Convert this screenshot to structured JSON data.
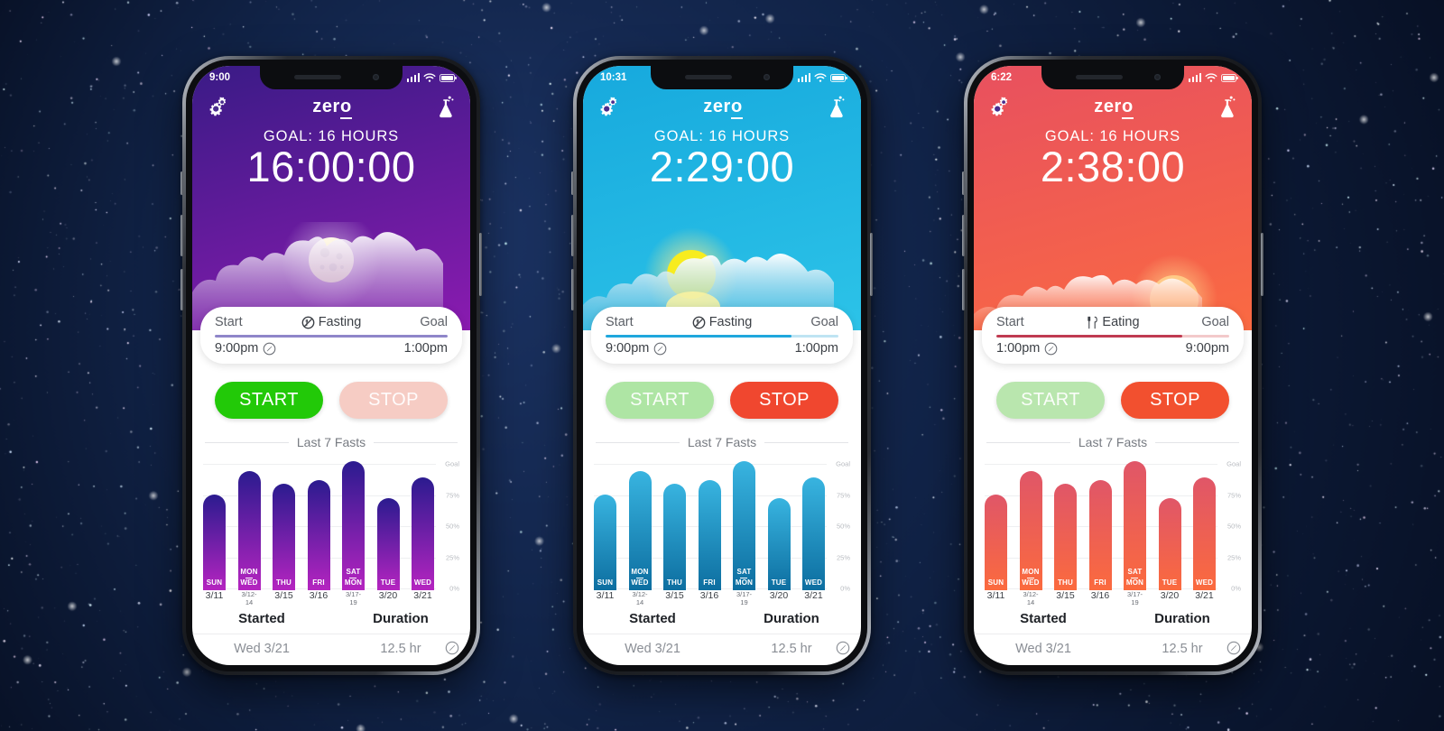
{
  "background": {
    "name": "starfield",
    "color": "#0b172e"
  },
  "phones": [
    {
      "id": "phone-night",
      "theme": {
        "sky_top": "#3a1b86",
        "sky_bottom": "#8a1bb0",
        "accent": "#7f5fd6",
        "bar_top": "#2b1b8f",
        "bar_bottom": "#b524c0",
        "progress_fill": "#8f86c9",
        "progress_track": "#cfcbe6",
        "scene": "moon"
      },
      "status_bar": {
        "time": "9:00",
        "signal_icon": "signal-bars-icon",
        "wifi_icon": "wifi-icon",
        "battery_icon": "battery-icon"
      },
      "app_bar": {
        "settings_icon": "gears-icon",
        "brand": "zer",
        "brand_tail": "o",
        "lab_icon": "flask-icon"
      },
      "goal_label": "GOAL: 16 HOURS",
      "timer": "16:00:00",
      "card": {
        "start_label": "Start",
        "state_icon": "no-food-icon",
        "state_label": "Fasting",
        "goal_label": "Goal",
        "start_time": "9:00pm",
        "edit_icon": "edit-pencil-icon",
        "goal_time": "1:00pm",
        "progress_percent": 100
      },
      "actions": {
        "start_label": "START",
        "start_enabled": true,
        "start_color": "#22c908",
        "start_disabled_color": "#b6e8ab",
        "stop_label": "STOP",
        "stop_enabled": false,
        "stop_color": "#f04b33",
        "stop_disabled_color": "#f6ccc4"
      },
      "chart_title": "Last 7 Fasts",
      "table": {
        "headers": [
          "Started",
          "Duration"
        ],
        "row": [
          "Wed 3/21",
          "12.5 hr"
        ],
        "edit_icon": "edit-pencil-icon"
      }
    },
    {
      "id": "phone-day",
      "theme": {
        "sky_top": "#17a9dd",
        "sky_bottom": "#2cc3e8",
        "accent": "#1b9fd8",
        "bar_top": "#38b4e0",
        "bar_bottom": "#0d6ea0",
        "progress_fill": "#1fa7dd",
        "progress_track": "#bfe4f3",
        "scene": "sun"
      },
      "status_bar": {
        "time": "10:31",
        "signal_icon": "signal-bars-icon",
        "wifi_icon": "wifi-icon",
        "battery_icon": "battery-icon"
      },
      "app_bar": {
        "settings_icon": "gears-icon",
        "brand": "zer",
        "brand_tail": "o",
        "lab_icon": "flask-icon"
      },
      "goal_label": "GOAL: 16 HOURS",
      "timer": "2:29:00",
      "card": {
        "start_label": "Start",
        "state_icon": "no-food-icon",
        "state_label": "Fasting",
        "goal_label": "Goal",
        "start_time": "9:00pm",
        "edit_icon": "edit-pencil-icon",
        "goal_time": "1:00pm",
        "progress_percent": 80
      },
      "actions": {
        "start_label": "START",
        "start_enabled": false,
        "start_color": "#22c908",
        "start_disabled_color": "#aee5a4",
        "stop_label": "STOP",
        "stop_enabled": true,
        "stop_color": "#f0472f",
        "stop_disabled_color": "#f6ccc4"
      },
      "chart_title": "Last 7 Fasts",
      "table": {
        "headers": [
          "Started",
          "Duration"
        ],
        "row": [
          "Wed 3/21",
          "12.5 hr"
        ],
        "edit_icon": "edit-pencil-icon"
      }
    },
    {
      "id": "phone-sunset",
      "theme": {
        "sky_top": "#e8505f",
        "sky_bottom": "#fa6a42",
        "accent": "#e8505f",
        "bar_top": "#e05668",
        "bar_bottom": "#fb6a3e",
        "progress_fill": "#c03b51",
        "progress_track": "#f3c9ca",
        "scene": "sunset"
      },
      "status_bar": {
        "time": "6:22",
        "signal_icon": "signal-bars-icon",
        "wifi_icon": "wifi-icon",
        "battery_icon": "battery-icon"
      },
      "app_bar": {
        "settings_icon": "gears-icon",
        "brand": "zer",
        "brand_tail": "o",
        "lab_icon": "flask-icon"
      },
      "goal_label": "GOAL: 16 HOURS",
      "timer": "2:38:00",
      "card": {
        "start_label": "Start",
        "state_icon": "utensils-icon",
        "state_label": "Eating",
        "goal_label": "Goal",
        "start_time": "1:00pm",
        "edit_icon": "edit-pencil-icon",
        "goal_time": "9:00pm",
        "progress_percent": 80
      },
      "actions": {
        "start_label": "START",
        "start_enabled": false,
        "start_color": "#22c908",
        "start_disabled_color": "#b9e6ae",
        "stop_label": "STOP",
        "stop_enabled": true,
        "stop_color": "#f2502f",
        "stop_disabled_color": "#f6ccc4"
      },
      "chart_title": "Last 7 Fasts",
      "table": {
        "headers": [
          "Started",
          "Duration"
        ],
        "row": [
          "Wed 3/21",
          "12.5 hr"
        ],
        "edit_icon": "edit-pencil-icon"
      }
    }
  ],
  "chart_data": {
    "type": "bar",
    "title": "Last 7 Fasts",
    "xlabel": "",
    "ylabel": "",
    "ylim": [
      0,
      110
    ],
    "grid": true,
    "legend": false,
    "y_ticks": [
      0,
      25,
      50,
      75,
      100
    ],
    "y_tick_labels": [
      "0%",
      "25%",
      "50%",
      "75%",
      "Goal"
    ],
    "categories": [
      "SUN",
      "MON\nWED",
      "THU",
      "FRI",
      "SAT\nMON",
      "TUE",
      "WED"
    ],
    "day_labels": [
      {
        "line1": "SUN",
        "line2": ""
      },
      {
        "line1": "MON",
        "line2": "WED"
      },
      {
        "line1": "THU",
        "line2": ""
      },
      {
        "line1": "FRI",
        "line2": ""
      },
      {
        "line1": "SAT",
        "line2": "MON"
      },
      {
        "line1": "TUE",
        "line2": ""
      },
      {
        "line1": "WED",
        "line2": ""
      }
    ],
    "x_tick_labels": [
      "3/11",
      "3/12-14",
      "3/15",
      "3/16",
      "3/17-19",
      "3/20",
      "3/21"
    ],
    "x_tick_small": [
      false,
      true,
      false,
      false,
      true,
      false,
      false
    ],
    "values": [
      78,
      97,
      87,
      90,
      105,
      75,
      92
    ]
  }
}
